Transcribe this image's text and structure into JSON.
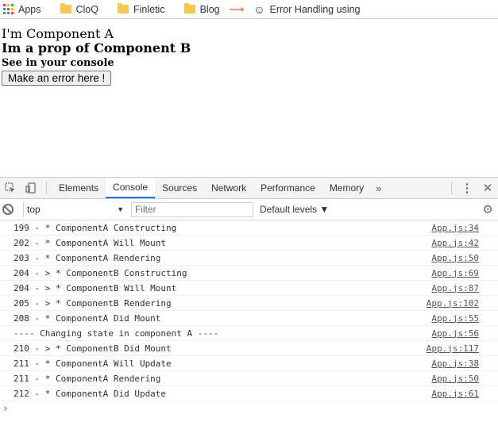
{
  "bookmarks": {
    "apps": "Apps",
    "items": [
      "CloQ",
      "Finletic",
      "Blog"
    ],
    "extra": "Error Handling using"
  },
  "page": {
    "line1": "I'm Component A",
    "line2": "Im a prop of Component B",
    "line3": "See in your console",
    "button": "Make an error here !"
  },
  "devtools": {
    "tabs": [
      "Elements",
      "Console",
      "Sources",
      "Network",
      "Performance",
      "Memory"
    ],
    "active_tab": "Console",
    "more": "»",
    "context": "top",
    "filter_placeholder": "Filter",
    "levels": "Default levels ▼",
    "accent": "#1a73e8",
    "logs": [
      {
        "msg": "199 - * ComponentA Constructing",
        "src": "App.js:34"
      },
      {
        "msg": "202 - * ComponentA Will Mount",
        "src": "App.js:42"
      },
      {
        "msg": "203 - * ComponentA Rendering",
        "src": "App.js:50"
      },
      {
        "msg": "204 - > * ComponentB Constructing",
        "src": "App.js:69"
      },
      {
        "msg": "204 - > * ComponentB Will Mount",
        "src": "App.js:87"
      },
      {
        "msg": "205 - > * ComponentB Rendering",
        "src": "App.js:102"
      },
      {
        "msg": "208 - * ComponentA Did Mount",
        "src": "App.js:55"
      },
      {
        "msg": "---- Changing state in component A ----",
        "src": "App.js:56"
      },
      {
        "msg": "210 - > * ComponentB Did Mount",
        "src": "App.js:117"
      },
      {
        "msg": "211 - * ComponentA Will Update",
        "src": "App.js:38"
      },
      {
        "msg": "211 - * ComponentA Rendering",
        "src": "App.js:50"
      },
      {
        "msg": "212 - * ComponentA Did Update",
        "src": "App.js:61"
      }
    ],
    "prompt": "›"
  }
}
